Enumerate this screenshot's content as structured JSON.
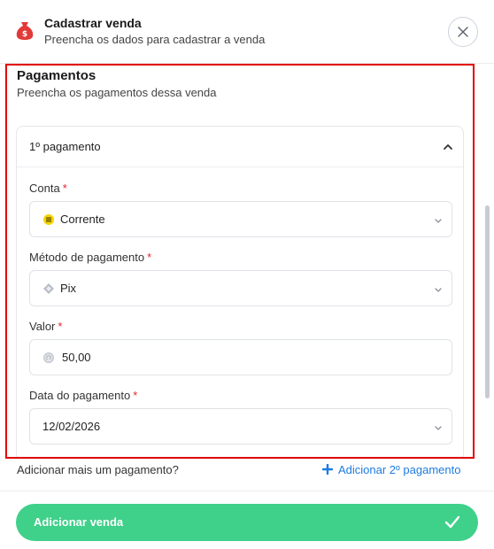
{
  "header": {
    "title": "Cadastrar venda",
    "subtitle": "Preencha os dados para cadastrar a venda"
  },
  "section": {
    "title": "Pagamentos",
    "subtitle": "Preencha os pagamentos dessa venda"
  },
  "payment": {
    "label": "1º pagamento",
    "fields": {
      "conta": {
        "label": "Conta",
        "value": "Corrente"
      },
      "metodo": {
        "label": "Método de pagamento",
        "value": "Pix"
      },
      "valor": {
        "label": "Valor",
        "value": "50,00"
      },
      "data": {
        "label": "Data do pagamento",
        "value": "12/02/2026"
      }
    },
    "required_mark": "*"
  },
  "more": {
    "question": "Adicionar mais um pagamento?",
    "add_label": "Adicionar 2º pagamento"
  },
  "footer": {
    "submit_label": "Adicionar venda"
  },
  "colors": {
    "accent_green": "#3fd08a",
    "link_blue": "#1e7be0",
    "required_red": "#e5252a",
    "highlight_red": "#e10000",
    "bag_red": "#e23a3a"
  },
  "icons": {
    "header": "money-bag-icon",
    "close": "close-icon",
    "collapse": "chevron-up-icon",
    "account": "bank-coin-icon",
    "method": "pix-icon",
    "amount": "coin-icon",
    "dropdown": "chevron-down-icon",
    "add": "plus-icon",
    "submit": "check-icon"
  }
}
